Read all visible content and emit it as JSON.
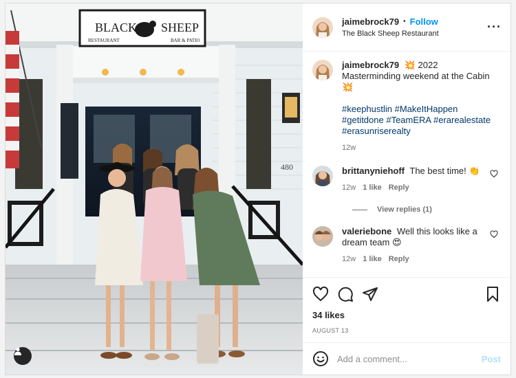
{
  "author": {
    "username": "jaimebrock79",
    "follow_label": "Follow",
    "location": "The Black Sheep Restaurant"
  },
  "photo": {
    "sign_main": "BLACK SHEEP",
    "sign_word1": "BLACK",
    "sign_word2": "SHEEP",
    "sign_left": "RESTAURANT",
    "sign_right": "BAR & PATIO",
    "address": "480",
    "tag_icon": "user-tag-icon"
  },
  "caption": {
    "username": "jaimebrock79",
    "text": "💥 2022\nMasterminding weekend at the Cabin\n💥",
    "hashtags": "#keephustlin #MakeItHappen #getitdone #TeamERA #erarealestate #erasunriserealty",
    "time": "12w"
  },
  "comments": [
    {
      "username": "brittanyniehoff",
      "text": "The best time! 👏",
      "time": "12w",
      "likes": "1 like",
      "reply": "Reply",
      "view_replies": "View replies (1)"
    },
    {
      "username": "valeriebone",
      "text": "Well this looks like a dream team 😍",
      "time": "12w",
      "likes": "1 like",
      "reply": "Reply"
    }
  ],
  "stats": {
    "likes": "34 likes",
    "date": "AUGUST 13"
  },
  "composer": {
    "placeholder": "Add a comment...",
    "post_label": "Post"
  },
  "icons": {
    "more": "more-options-icon",
    "like": "heart-icon",
    "comment": "comment-icon",
    "share": "share-icon",
    "save": "bookmark-icon",
    "emoji": "emoji-icon"
  },
  "colors": {
    "link": "#0095f6",
    "hashtag": "#00376b",
    "muted": "#737373",
    "post_disabled": "#b2dffc"
  }
}
